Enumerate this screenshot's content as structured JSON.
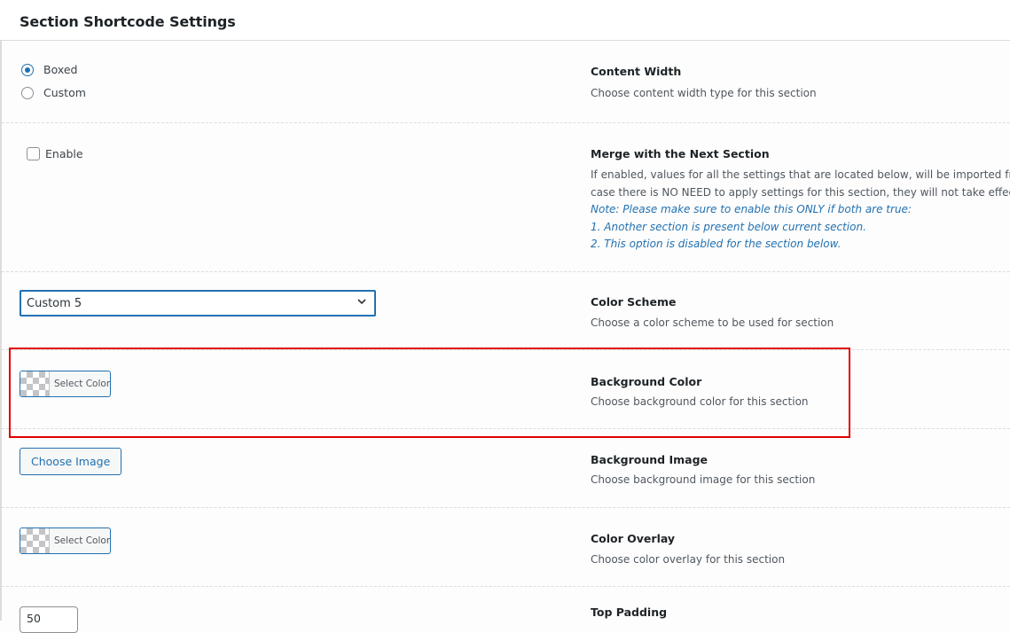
{
  "page": {
    "heading": "Section Shortcode Settings"
  },
  "content_width": {
    "title": "Content Width",
    "description": "Choose content width type for this section",
    "options": [
      {
        "label": "Boxed",
        "checked": true
      },
      {
        "label": "Custom",
        "checked": false
      }
    ]
  },
  "merge": {
    "title": "Merge with the Next Section",
    "checkbox_label": "Enable",
    "checked": false,
    "description_line1": "If enabled, values for all the settings that are located below, will be imported from t",
    "description_line2": "case there is NO NEED to apply settings for this section, they will not take effect.",
    "note_line1": "Note: Please make sure to enable this ONLY if both are true:",
    "note_line2": "1. Another section is present below current section.",
    "note_line3": "2. This option is disabled for the section below."
  },
  "color_scheme": {
    "title": "Color Scheme",
    "description": "Choose a color scheme to be used for section",
    "selected": "Custom 5",
    "chevron_icon": "chevron-down-icon"
  },
  "background_color": {
    "title": "Background Color",
    "description": "Choose background color for this section",
    "button_label": "Select Color"
  },
  "background_image": {
    "title": "Background Image",
    "description": "Choose background image for this section",
    "button_label": "Choose Image"
  },
  "color_overlay": {
    "title": "Color Overlay",
    "description": "Choose color overlay for this section",
    "button_label": "Select Color"
  },
  "top_padding": {
    "title": "Top Padding",
    "value": "50"
  },
  "colors": {
    "accent": "#2271b1",
    "highlight": "#e00000"
  }
}
